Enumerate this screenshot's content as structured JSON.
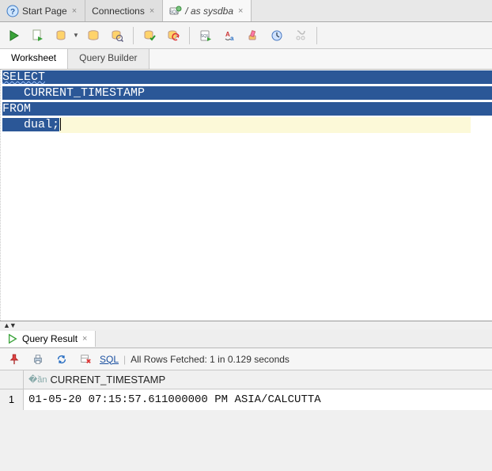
{
  "conn_tabs": [
    {
      "icon": "help",
      "label": "Start Page"
    },
    {
      "icon": "none",
      "label": "Connections"
    },
    {
      "icon": "sql-conn",
      "label": "/ as sysdba",
      "active": true
    }
  ],
  "toolbar_icons": [
    "run",
    "run-script",
    "db-dd",
    "explain-plan",
    "autotrace",
    "sep",
    "commit",
    "rollback",
    "sep",
    "sql-file",
    "find-replace",
    "clear",
    "history",
    "snippet"
  ],
  "ws_tabs": {
    "worksheet": "Worksheet",
    "query_builder": "Query Builder"
  },
  "sql": {
    "l1": "SELECT",
    "l2": "   CURRENT_TIMESTAMP",
    "l3": "FROM",
    "l4_pre": "   dual;"
  },
  "result_tab_label": "Query Result",
  "result_toolbar": {
    "sql_label": "SQL",
    "status": "All Rows Fetched: 1 in 0.129 seconds"
  },
  "result": {
    "column": "CURRENT_TIMESTAMP",
    "rownum": "1",
    "value": "01-05-20 07:15:57.611000000 PM ASIA/CALCUTTA"
  }
}
